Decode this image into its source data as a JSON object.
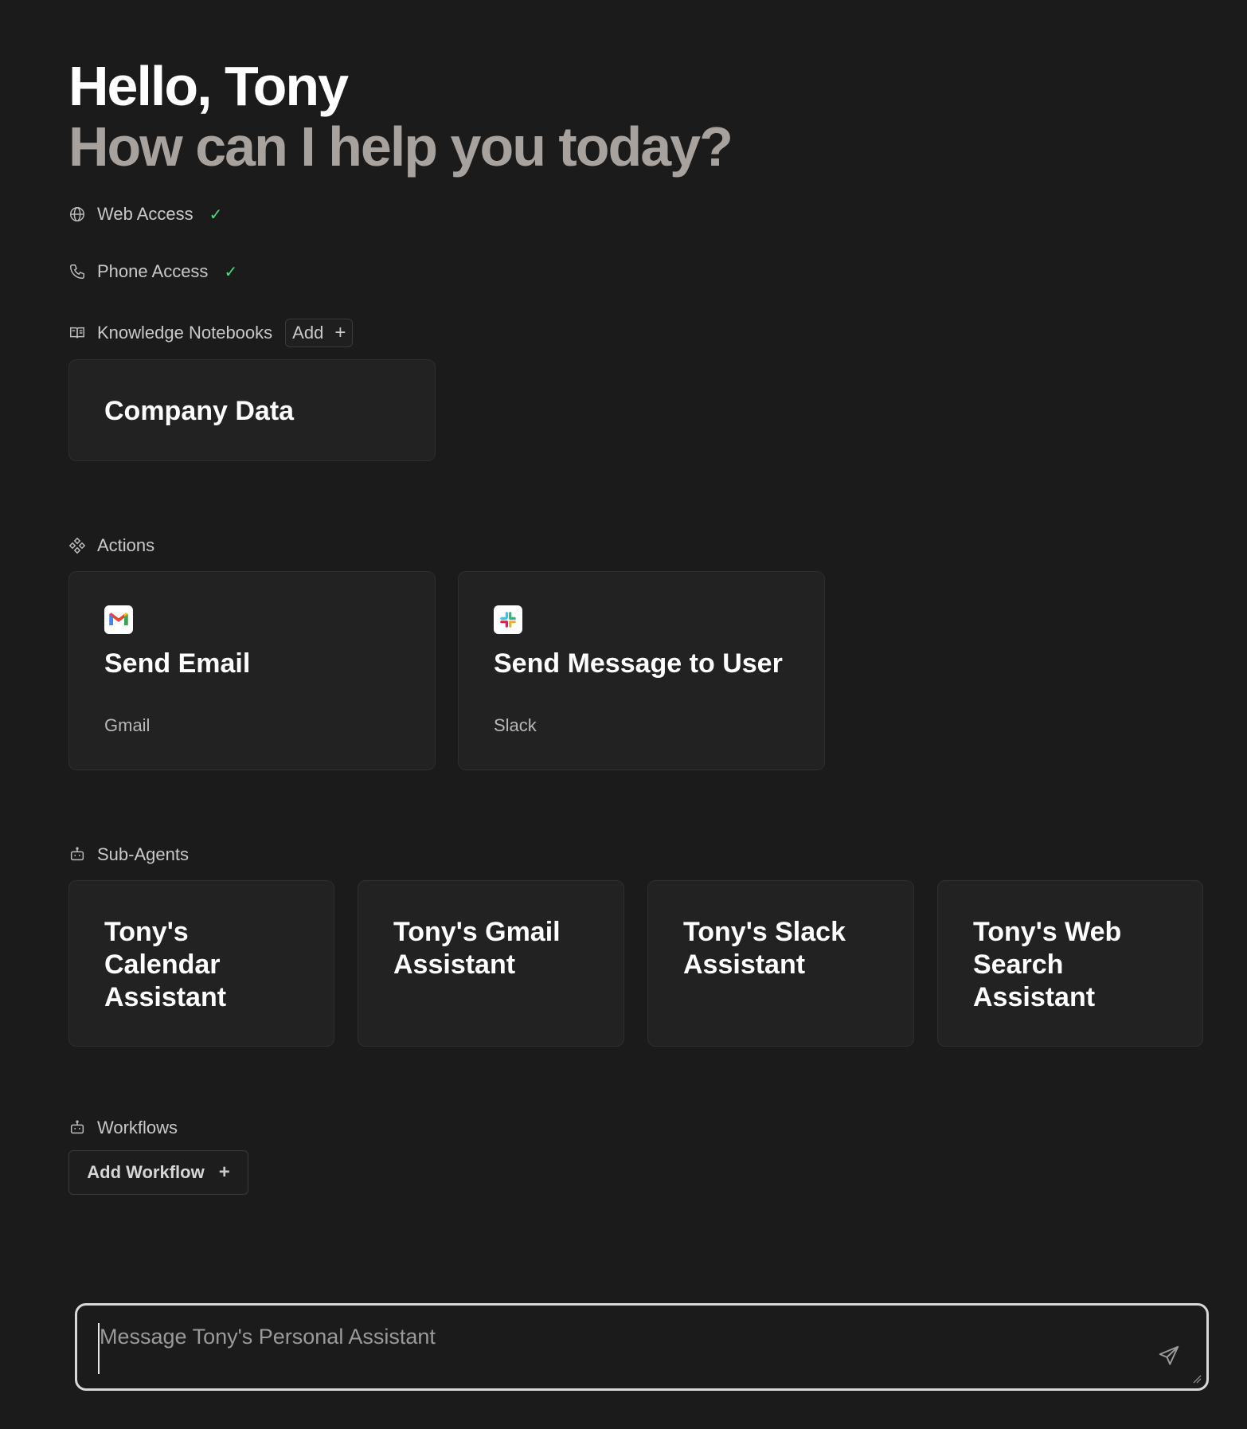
{
  "greeting": {
    "hello": "Hello, Tony",
    "subtitle": "How can I help you today?"
  },
  "capabilities": {
    "web_access": {
      "label": "Web Access",
      "status": "✓",
      "icon": "globe-icon"
    },
    "phone_access": {
      "label": "Phone Access",
      "status": "✓",
      "icon": "phone-icon"
    }
  },
  "knowledge": {
    "label": "Knowledge Notebooks",
    "icon": "book-icon",
    "add_label": "Add",
    "add_icon": "+",
    "notebooks": [
      {
        "title": "Company Data"
      }
    ]
  },
  "actions": {
    "label": "Actions",
    "icon": "actions-icon",
    "items": [
      {
        "title": "Send Email",
        "provider": "Gmail",
        "icon": "gmail-icon"
      },
      {
        "title": "Send Message to User",
        "provider": "Slack",
        "icon": "slack-icon"
      }
    ]
  },
  "sub_agents": {
    "label": "Sub-Agents",
    "icon": "robot-icon",
    "items": [
      {
        "title": "Tony's Calendar Assistant"
      },
      {
        "title": "Tony's Gmail Assistant"
      },
      {
        "title": "Tony's Slack Assistant"
      },
      {
        "title": "Tony's Web Search Assistant"
      }
    ]
  },
  "workflows": {
    "label": "Workflows",
    "icon": "robot-icon",
    "add_label": "Add Workflow",
    "add_icon": "+"
  },
  "composer": {
    "placeholder": "Message Tony's Personal Assistant",
    "value": "",
    "send_icon": "send-icon"
  },
  "colors": {
    "background": "#1b1b1b",
    "card": "#222222",
    "check": "#4ade80",
    "subtitle": "#a8a29e"
  }
}
